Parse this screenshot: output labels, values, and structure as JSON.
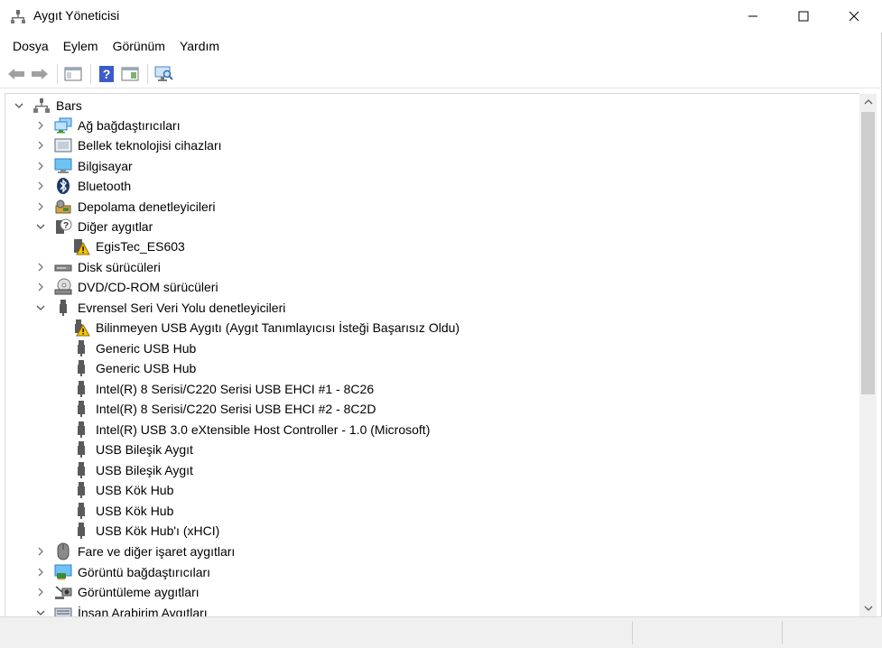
{
  "window": {
    "title": "Aygıt Yöneticisi",
    "controls": {
      "minimize": "minimize-icon",
      "maximize": "maximize-icon",
      "close": "close-icon"
    }
  },
  "menu": {
    "items": [
      "Dosya",
      "Eylem",
      "Görünüm",
      "Yardım"
    ]
  },
  "toolbar": {
    "buttons": [
      "back-icon",
      "forward-icon",
      "show-hide-console-tree-icon",
      "help-icon",
      "properties-panel-icon",
      "scan-hardware-icon"
    ]
  },
  "tree": {
    "root": "Bars",
    "nodes": [
      {
        "label": "Ağ bağdaştırıcıları",
        "icon": "network-adapter-icon",
        "state": "collapsed"
      },
      {
        "label": "Bellek teknolojisi cihazları",
        "icon": "memory-device-icon",
        "state": "collapsed"
      },
      {
        "label": "Bilgisayar",
        "icon": "computer-icon",
        "state": "collapsed"
      },
      {
        "label": "Bluetooth",
        "icon": "bluetooth-icon",
        "state": "collapsed"
      },
      {
        "label": "Depolama denetleyicileri",
        "icon": "storage-controller-icon",
        "state": "collapsed"
      },
      {
        "label": "Diğer aygıtlar",
        "icon": "other-devices-icon",
        "state": "expanded"
      },
      {
        "label": "EgisTec_ES603",
        "icon": "warning-device-icon",
        "state": "child"
      },
      {
        "label": "Disk sürücüleri",
        "icon": "disk-drive-icon",
        "state": "collapsed"
      },
      {
        "label": "DVD/CD-ROM sürücüleri",
        "icon": "dvd-drive-icon",
        "state": "collapsed"
      },
      {
        "label": "Evrensel Seri Veri Yolu denetleyicileri",
        "icon": "usb-icon",
        "state": "expanded"
      },
      {
        "label": "Bilinmeyen USB Aygıtı (Aygıt Tanımlayıcısı İsteği Başarısız Oldu)",
        "icon": "usb-warning-icon",
        "state": "child"
      },
      {
        "label": "Generic USB Hub",
        "icon": "usb-icon",
        "state": "child"
      },
      {
        "label": "Generic USB Hub",
        "icon": "usb-icon",
        "state": "child"
      },
      {
        "label": "Intel(R) 8 Serisi/C220 Serisi USB EHCI #1 - 8C26",
        "icon": "usb-icon",
        "state": "child"
      },
      {
        "label": "Intel(R) 8 Serisi/C220 Serisi USB EHCI #2 - 8C2D",
        "icon": "usb-icon",
        "state": "child"
      },
      {
        "label": "Intel(R) USB 3.0 eXtensible Host Controller - 1.0 (Microsoft)",
        "icon": "usb-icon",
        "state": "child"
      },
      {
        "label": "USB Bileşik Aygıt",
        "icon": "usb-icon",
        "state": "child"
      },
      {
        "label": "USB Bileşik Aygıt",
        "icon": "usb-icon",
        "state": "child"
      },
      {
        "label": "USB Kök Hub",
        "icon": "usb-icon",
        "state": "child"
      },
      {
        "label": "USB Kök Hub",
        "icon": "usb-icon",
        "state": "child"
      },
      {
        "label": "USB Kök Hub'ı (xHCI)",
        "icon": "usb-icon",
        "state": "child"
      },
      {
        "label": "Fare ve diğer işaret aygıtları",
        "icon": "mouse-icon",
        "state": "collapsed"
      },
      {
        "label": "Görüntü bağdaştırıcıları",
        "icon": "display-adapter-icon",
        "state": "collapsed"
      },
      {
        "label": "Görüntüleme aygıtları",
        "icon": "imaging-device-icon",
        "state": "collapsed"
      },
      {
        "label": "İnsan Arabirim Aygıtları",
        "icon": "hid-icon",
        "state": "expanded"
      }
    ]
  },
  "colors": {
    "warning": "#f5c400",
    "usb_gray": "#5a5a5a",
    "network_blue": "#2f7fcf",
    "chevron": "#606060"
  }
}
